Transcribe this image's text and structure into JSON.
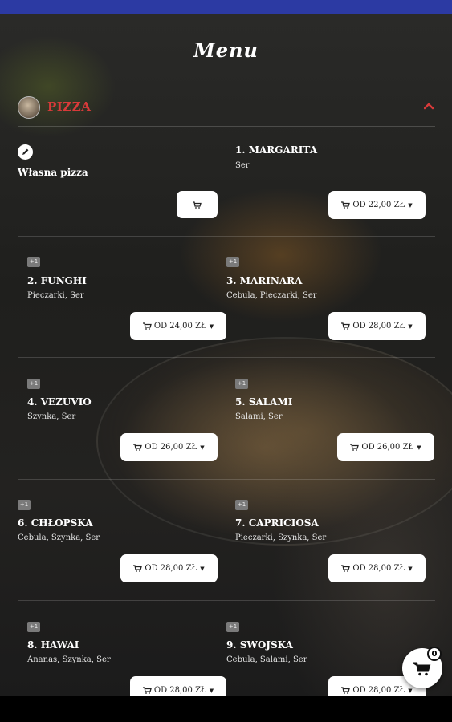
{
  "header": {
    "title": "Menu"
  },
  "category": {
    "label": "PIZZA",
    "icon": "pizza-icon"
  },
  "custom_item": {
    "label": "Własna pizza",
    "icon": "edit-icon"
  },
  "badge_label": "+1",
  "items": [
    {
      "name": "1. MARGARITA",
      "description": "Ser",
      "price": "OD 22,00 ZŁ",
      "has_badge": false
    },
    {
      "name": "2. FUNGHI",
      "description": "Pieczarki, Ser",
      "price": "OD 24,00 ZŁ",
      "has_badge": true
    },
    {
      "name": "3. MARINARA",
      "description": "Cebula, Pieczarki, Ser",
      "price": "OD 28,00 ZŁ",
      "has_badge": true
    },
    {
      "name": "4. VEZUVIO",
      "description": "Szynka, Ser",
      "price": "OD 26,00 ZŁ",
      "has_badge": true
    },
    {
      "name": "5. SALAMI",
      "description": "Salami, Ser",
      "price": "OD 26,00 ZŁ",
      "has_badge": true
    },
    {
      "name": "6. CHŁOPSKA",
      "description": "Cebula, Szynka, Ser",
      "price": "OD 28,00 ZŁ",
      "has_badge": true
    },
    {
      "name": "7. CAPRICIOSA",
      "description": "Pieczarki, Szynka, Ser",
      "price": "OD 28,00 ZŁ",
      "has_badge": true
    },
    {
      "name": "8. HAWAI",
      "description": "Ananas, Szynka, Ser",
      "price": "OD 28,00 ZŁ",
      "has_badge": true
    },
    {
      "name": "9. SWOJSKA",
      "description": "Cebula, Salami, Ser",
      "price": "OD 28,00 ZŁ",
      "has_badge": true
    }
  ],
  "cart": {
    "count": "0",
    "icon": "cart-icon"
  },
  "colors": {
    "status_bar": "#2c3aa3",
    "category_accent": "#d83a3a",
    "button_bg": "#ffffff"
  }
}
